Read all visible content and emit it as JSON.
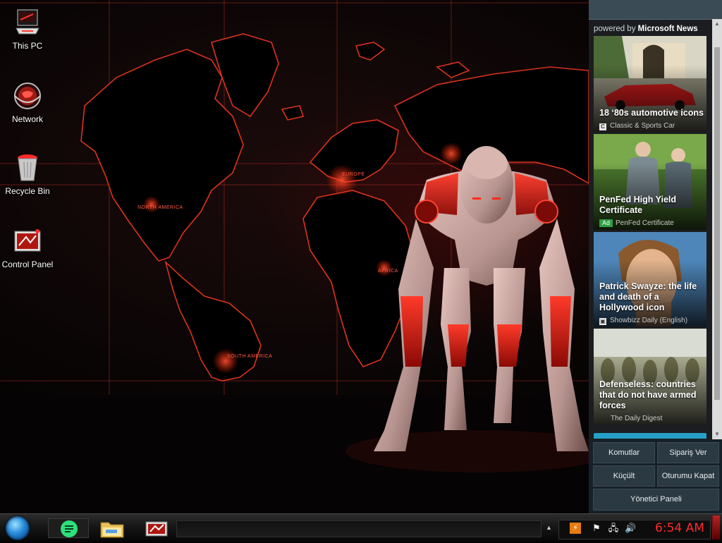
{
  "desktop": {
    "icons": [
      {
        "label": "This PC"
      },
      {
        "label": "Network"
      },
      {
        "label": "Recycle Bin"
      },
      {
        "label": "Control Panel"
      }
    ],
    "wallpaper_labels": {
      "north_america": "NORTH AMERICA",
      "south_america": "SOUTH AMERICA",
      "europe": "EUROPE",
      "africa": "AFRICA"
    }
  },
  "news": {
    "powered_prefix": "powered by",
    "powered_brand": "Microsoft News",
    "cards": [
      {
        "title": "18 ‘80s automotive icons",
        "source": "Classic & Sports Car",
        "badge": "C"
      },
      {
        "title": "PenFed High Yield Certificate",
        "source": "PenFed Certificate",
        "ad": "Ad"
      },
      {
        "title": "Patrick Swayze: the life and death of a Hollywood icon",
        "source": "Showbizz Daily (English)"
      },
      {
        "title": "Defenseless: countries that do not have armed forces",
        "source": "The Daily Digest"
      }
    ]
  },
  "commands": {
    "komutlar": "Komutlar",
    "siparis_ver": "Sipariş Ver",
    "kucult": "Küçült",
    "oturumu_kapat": "Oturumu Kapat",
    "yonetici_paneli": "Yönetici Paneli"
  },
  "taskbar": {
    "clock": "6:54 AM",
    "pinned": [
      "notes-app-icon",
      "file-explorer-icon",
      "control-panel-icon"
    ]
  },
  "colors": {
    "accent_red": "#ff2a2a",
    "panel_bg": "#1b1d20",
    "command_button": "#2b3942",
    "search_bar": "#25a0c9"
  }
}
